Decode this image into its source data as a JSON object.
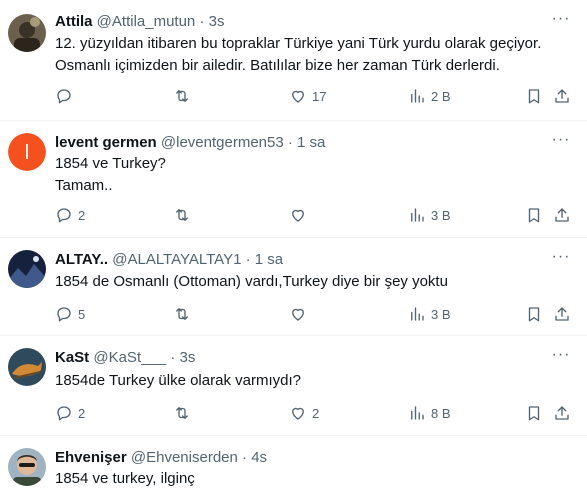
{
  "tweets": [
    {
      "name": "Attila",
      "handle": "@Attila_mutun",
      "time": "3s",
      "text": "12. yüzyıldan itibaren bu topraklar Türkiye yani Türk yurdu olarak geçiyor.\nOsmanlı içimizden bir ailedir. Batılılar bize her zaman Türk derlerdi.",
      "replies": "",
      "retweets": "",
      "likes": "17",
      "views": "2 B",
      "avatar_color": "#5a5040"
    },
    {
      "name": "levent germen",
      "handle": "@leventgermen53",
      "time": "1 sa",
      "text": "1854 ve Turkey?\nTamam..",
      "replies": "2",
      "retweets": "",
      "likes": "",
      "views": "3 B",
      "avatar_letter": "l",
      "avatar_color": "#f4511e"
    },
    {
      "name": "ALTAY..",
      "handle": "@ALALTAYALTAY1",
      "time": "1 sa",
      "text": "1854 de Osmanlı (Ottoman) vardı,Turkey diye bir şey yoktu",
      "replies": "5",
      "retweets": "",
      "likes": "",
      "views": "3 B",
      "avatar_color": "#1b2a4a"
    },
    {
      "name": "KaSt",
      "handle": "@KaSt___",
      "time": "3s",
      "text": "1854de Turkey ülke olarak varmıydı?",
      "replies": "2",
      "retweets": "",
      "likes": "2",
      "views": "8 B",
      "avatar_color": "#c9812f"
    },
    {
      "name": "Ehvenişer",
      "handle": "@Ehveniserden",
      "time": "4s",
      "text": "1854 ve turkey, ilginç",
      "replies": "",
      "retweets": "",
      "likes": "",
      "views": "",
      "avatar_color": "#8aa0b0"
    }
  ],
  "ui": {
    "dot": "·",
    "more": "···"
  },
  "icons": {
    "reply": "reply-icon",
    "retweet": "retweet-icon",
    "like": "heart-icon",
    "views": "views-icon",
    "bookmark": "bookmark-icon",
    "share": "share-icon",
    "more": "more-icon"
  },
  "colors": {
    "text": "#0f1419",
    "secondary": "#536471",
    "divider": "#eff3f4"
  }
}
